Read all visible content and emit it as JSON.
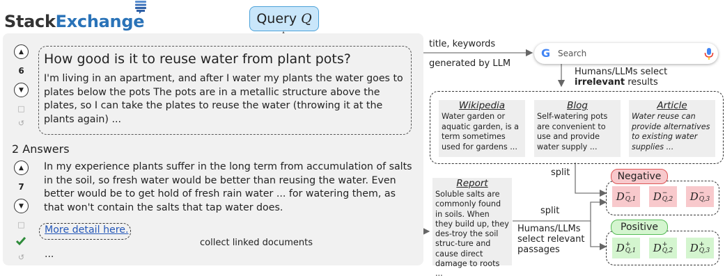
{
  "logo": {
    "part1": "Stack",
    "part2": "Exchange"
  },
  "query": {
    "label": "Query",
    "symbol": "Q"
  },
  "question": {
    "upvotes": "6",
    "title": "How good is it to reuse water from plant pots?",
    "body": "I'm living in an apartment, and after I water my plants the water goes to plates below the pots The pots are in a metallic structure above the plates, so I can take the plates to reuse the water (throwing it at the plants again) ..."
  },
  "answers": {
    "heading": "2 Answers",
    "upvotes": "7",
    "body": "In my experience plants suffer in the long term from accumulation of salts in the soil, so fresh water would be better than reusing the water. Even better would be to get hold of fresh rain water ... for watering them, as that won't contain the salts that tap water does.",
    "link": "More detail here.",
    "ellipsis": "..."
  },
  "labels": {
    "title_keywords": "title, keywords",
    "generated_by_llm": "generated by LLM",
    "select_irrelevant_1": "Humans/LLMs select",
    "select_irrelevant_bold": "irrelevant",
    "select_irrelevant_2": " results",
    "split_top": "split",
    "split_mid": "split",
    "select_relevant": "Humans/LLMs\nselect relevant\npassages",
    "collect": "collect linked documents"
  },
  "search": {
    "placeholder": "Search",
    "g": "G"
  },
  "irrelevant_docs": [
    {
      "title": "Wikipedia",
      "text": "Water garden or aquatic garden, is a term sometimes used for gardens ...",
      "italic": false
    },
    {
      "title": "Blog",
      "text": "Self-watering pots are convenient to use and provide water supply ...",
      "italic": false
    },
    {
      "title": "Article",
      "text": "Water reuse can provide alternatives to existing water supplies ...",
      "italic": true
    }
  ],
  "report": {
    "title": "Report",
    "text": "Soluble salts are commonly found in soils. When they build up, they des-troy the soil struc-ture and cause direct damage to roots ..."
  },
  "negative": {
    "label": "Negative",
    "items": [
      "1",
      "2",
      "3"
    ]
  },
  "positive": {
    "label": "Positive",
    "items": [
      "1",
      "2",
      "3"
    ]
  },
  "colors": {
    "brand_blue": "#2a73b8",
    "negative": "#f8c9cc",
    "positive": "#d4f5cf",
    "query": "#c9e6fa"
  }
}
